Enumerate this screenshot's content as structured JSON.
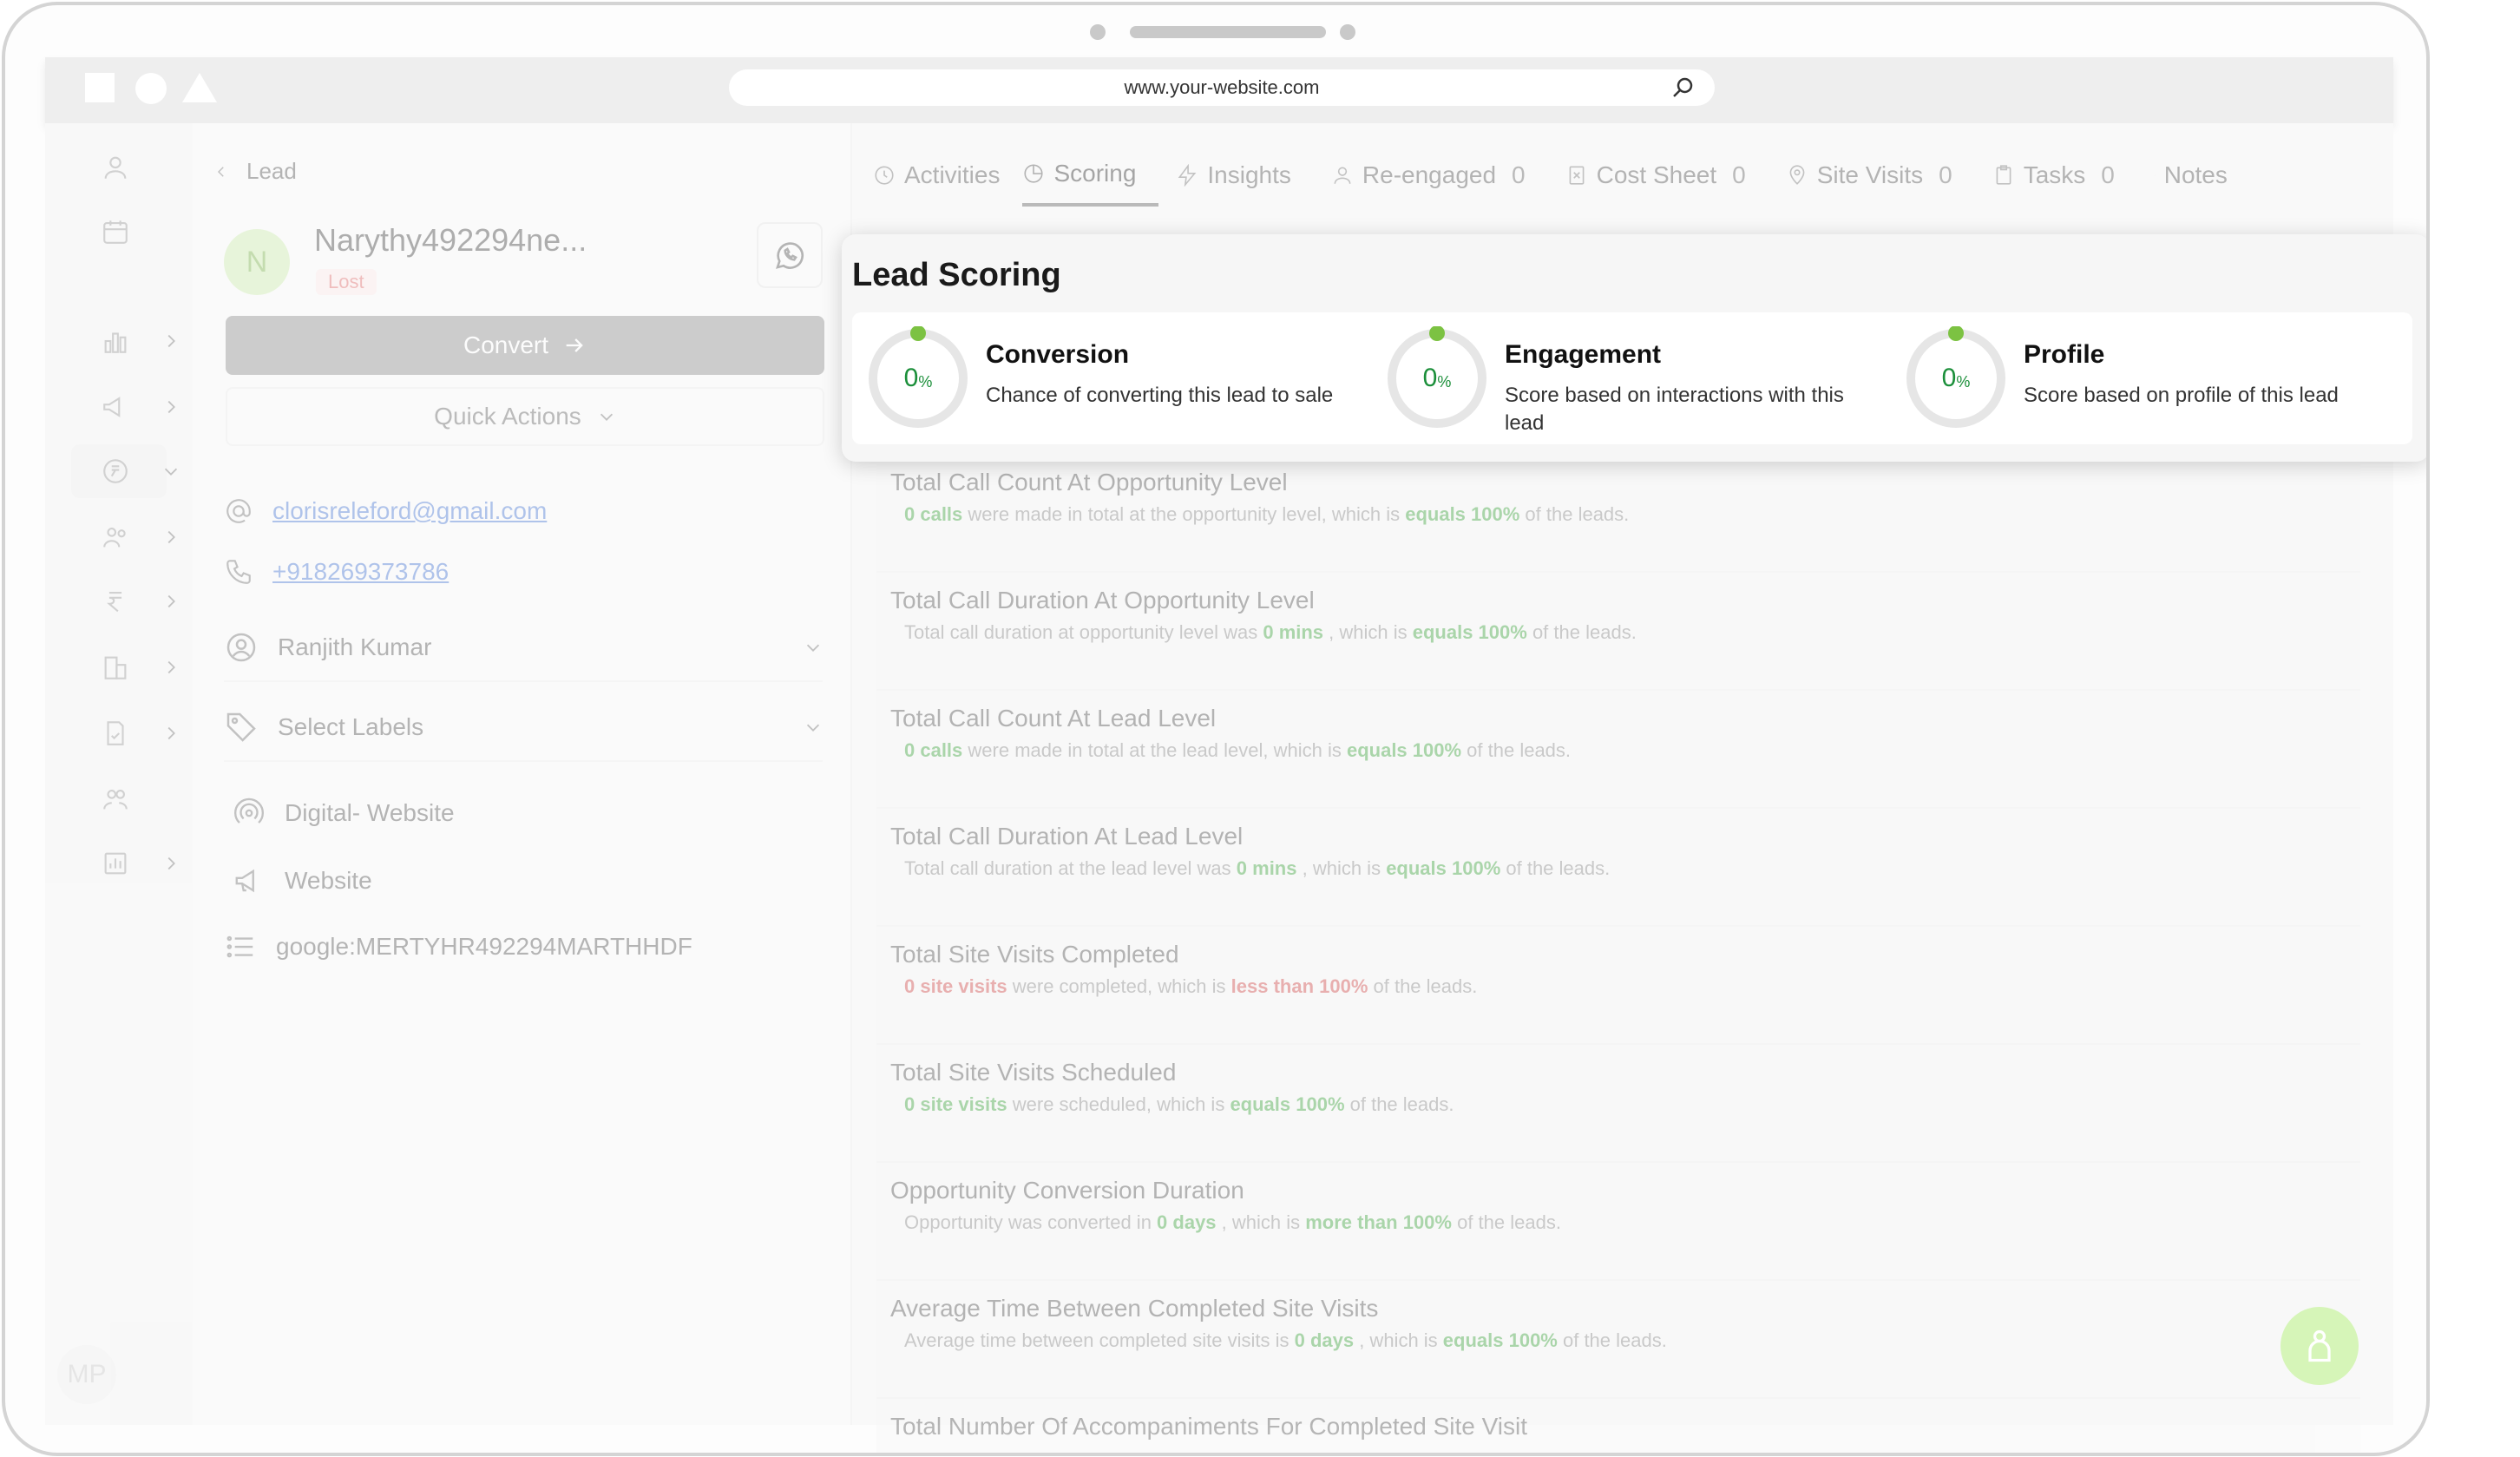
{
  "browser": {
    "url": "www.your-website.com"
  },
  "rail": {
    "user_initials": "MP"
  },
  "lead": {
    "back_label": "Lead",
    "avatar_initial": "N",
    "name": "Narythy492294ne...",
    "status": "Lost",
    "convert_label": "Convert",
    "quick_actions_label": "Quick Actions",
    "email": "clorisreleford@gmail.com",
    "phone": "+918269373786",
    "owner": "Ranjith Kumar",
    "labels_placeholder": "Select Labels",
    "source": "Digital- Website",
    "sub_source": "Website",
    "campaign": "google:MERTYHR492294MARTHHDF"
  },
  "tabs": [
    {
      "label": "Activities",
      "count": ""
    },
    {
      "label": "Scoring",
      "count": ""
    },
    {
      "label": "Insights",
      "count": ""
    },
    {
      "label": "Re-engaged",
      "count": "0"
    },
    {
      "label": "Cost Sheet",
      "count": "0"
    },
    {
      "label": "Site Visits",
      "count": "0"
    },
    {
      "label": "Tasks",
      "count": "0"
    },
    {
      "label": "Notes",
      "count": ""
    }
  ],
  "scoring": {
    "title": "Lead Scoring",
    "items": [
      {
        "name": "Conversion",
        "value": "0",
        "unit": "%",
        "description": "Chance of converting this lead to sale"
      },
      {
        "name": "Engagement",
        "value": "0",
        "unit": "%",
        "description": "Score based on interactions with this lead"
      },
      {
        "name": "Profile",
        "value": "0",
        "unit": "%",
        "description": "Score based on profile of this lead"
      }
    ],
    "colors": {
      "value": "#1b8f3a",
      "dot": "#7cc242",
      "track": "#e6e6e6"
    }
  },
  "metrics": [
    {
      "title": "Total Call Count At Opportunity Level",
      "pre": "",
      "hl1": "0 calls",
      "mid": " were made in total at the opportunity level, which is ",
      "hl2": "equals 100%",
      "post": " of the leads.",
      "tone": "g"
    },
    {
      "title": "Total Call Duration At Opportunity Level",
      "pre": "Total call duration at opportunity level was ",
      "hl1": "0 mins",
      "mid": " , which is ",
      "hl2": "equals 100%",
      "post": " of the leads.",
      "tone": "g"
    },
    {
      "title": "Total Call Count At Lead Level",
      "pre": "",
      "hl1": "0 calls",
      "mid": " were made in total at the lead level, which is ",
      "hl2": "equals 100%",
      "post": " of the leads.",
      "tone": "g"
    },
    {
      "title": "Total Call Duration At Lead Level",
      "pre": "Total call duration at the lead level was ",
      "hl1": "0 mins",
      "mid": " , which is ",
      "hl2": "equals 100%",
      "post": " of the leads.",
      "tone": "g"
    },
    {
      "title": "Total Site Visits Completed",
      "pre": "",
      "hl1": "0 site visits",
      "mid": " were completed, which is ",
      "hl2": "less than 100%",
      "post": " of the leads.",
      "tone": "r"
    },
    {
      "title": "Total Site Visits Scheduled",
      "pre": "",
      "hl1": "0 site visits",
      "mid": " were scheduled, which is ",
      "hl2": "equals 100%",
      "post": " of the leads.",
      "tone": "g"
    },
    {
      "title": "Opportunity Conversion Duration",
      "pre": "Opportunity was converted in ",
      "hl1": "0 days",
      "mid": " , which is ",
      "hl2": "more than 100%",
      "post": " of the leads.",
      "tone": "g"
    },
    {
      "title": "Average Time Between Completed Site Visits",
      "pre": "Average time between completed site visits is ",
      "hl1": "0 days",
      "mid": " , which is ",
      "hl2": "equals 100%",
      "post": " of the leads.",
      "tone": "g"
    },
    {
      "title": "Total Number Of Accompaniments For Completed Site Visit",
      "pre": "",
      "hl1": "",
      "mid": "",
      "hl2": "",
      "post": "",
      "tone": "g"
    }
  ]
}
